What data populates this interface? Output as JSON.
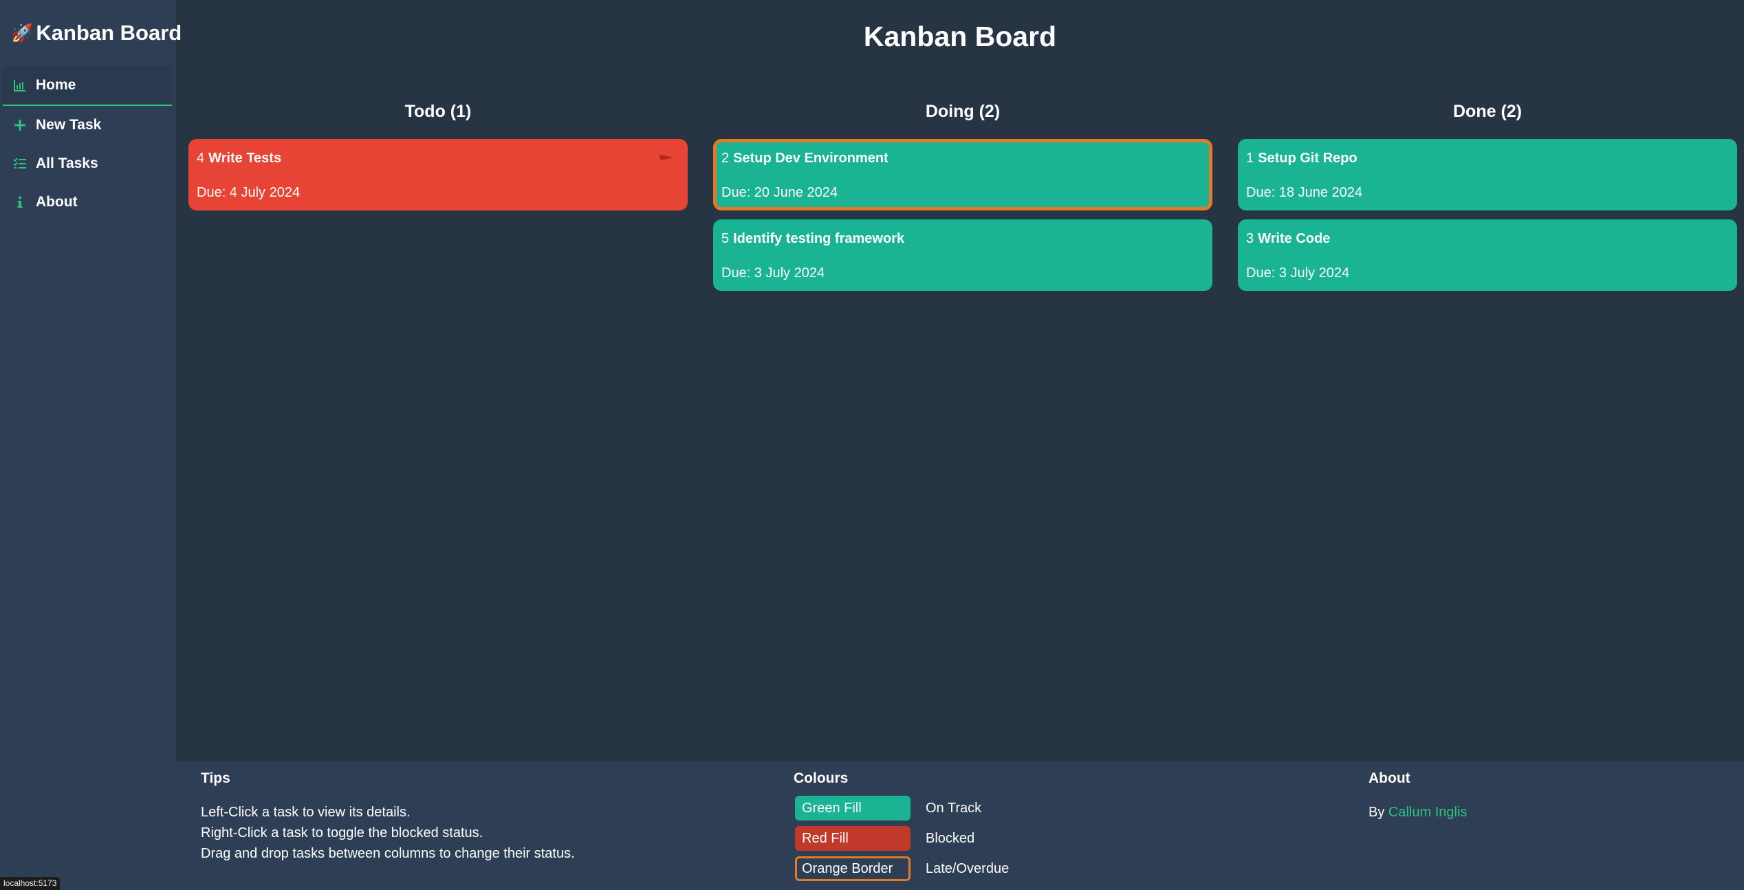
{
  "sidebar": {
    "brand_emoji": "🚀",
    "brand": "Kanban Board",
    "items": [
      {
        "label": "Home",
        "icon": "chart-icon",
        "active": true
      },
      {
        "label": "New Task",
        "icon": "plus-icon"
      },
      {
        "label": "All Tasks",
        "icon": "list-icon"
      },
      {
        "label": "About",
        "icon": "info-icon"
      }
    ]
  },
  "main": {
    "title": "Kanban Board",
    "columns": [
      {
        "header": "Todo (1)",
        "tasks": [
          {
            "id": "4",
            "title": "Write Tests",
            "due": "Due: 4 July 2024",
            "status": "blocked",
            "flag_icon": "flag-icon"
          }
        ]
      },
      {
        "header": "Doing (2)",
        "tasks": [
          {
            "id": "2",
            "title": "Setup Dev Environment",
            "due": "Due: 20 June 2024",
            "status": "on-track",
            "late": true
          },
          {
            "id": "5",
            "title": "Identify testing framework",
            "due": "Due: 3 July 2024",
            "status": "on-track"
          }
        ]
      },
      {
        "header": "Done (2)",
        "tasks": [
          {
            "id": "1",
            "title": "Setup Git Repo",
            "due": "Due: 18 June 2024",
            "status": "on-track"
          },
          {
            "id": "3",
            "title": "Write Code",
            "due": "Due: 3 July 2024",
            "status": "on-track"
          }
        ]
      }
    ]
  },
  "footer": {
    "tips": {
      "heading": "Tips",
      "lines": [
        "Left-Click a task to view its details.",
        "Right-Click a task to toggle the blocked status.",
        "Drag and drop tasks between columns to change their status."
      ]
    },
    "colours": {
      "heading": "Colours",
      "legend": [
        {
          "swatch": "Green Fill",
          "meaning": "On Track",
          "color": "#1ab394"
        },
        {
          "swatch": "Red Fill",
          "meaning": "Blocked",
          "color": "#c0392b"
        },
        {
          "swatch": "Orange Border",
          "meaning": "Late/Overdue",
          "color": "#e27a26"
        }
      ]
    },
    "about": {
      "heading": "About",
      "by": "By",
      "author": "Callum Inglis"
    }
  },
  "status_bar": {
    "url": "localhost:5173"
  },
  "colors": {
    "accent": "#2ec27e",
    "on_track": "#1ab394",
    "blocked": "#e74435",
    "late_border": "#e27a26",
    "background": "#273444",
    "panel": "#2e3f55"
  }
}
